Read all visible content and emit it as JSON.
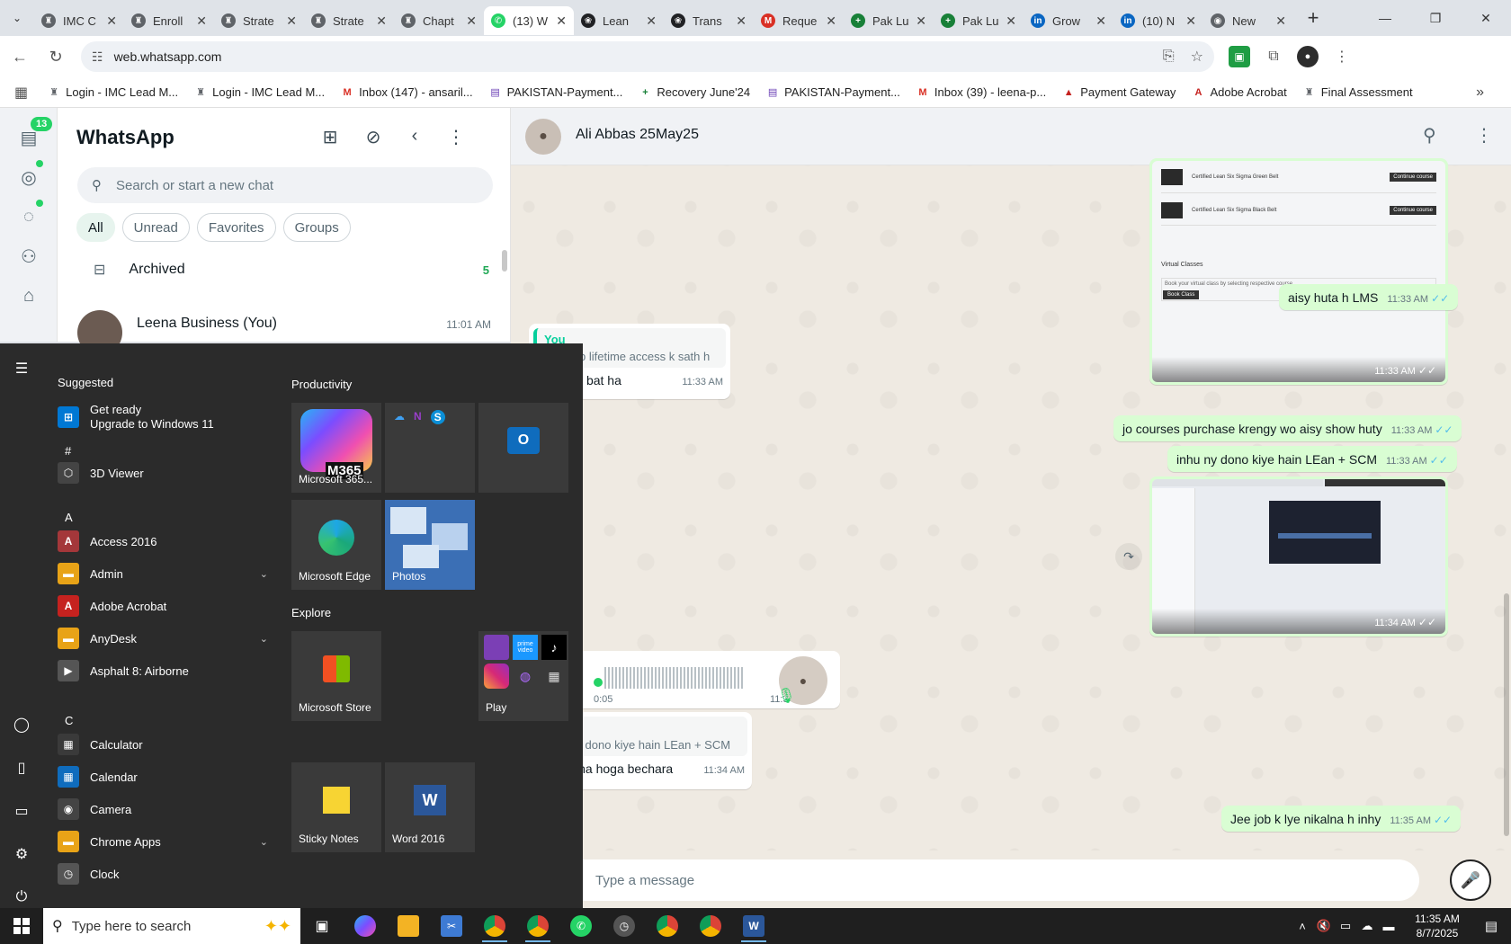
{
  "browser": {
    "tabs": [
      {
        "title": "IMC C",
        "color": "#5f6368",
        "glyph": "♜"
      },
      {
        "title": "Enroll",
        "color": "#5f6368",
        "glyph": "♜"
      },
      {
        "title": "Strate",
        "color": "#5f6368",
        "glyph": "♜"
      },
      {
        "title": "Strate",
        "color": "#5f6368",
        "glyph": "♜"
      },
      {
        "title": "Chapt",
        "color": "#5f6368",
        "glyph": "♜"
      },
      {
        "title": "(13) W",
        "color": "#25d366",
        "glyph": "✆"
      },
      {
        "title": "Lean",
        "color": "#202124",
        "glyph": "❀"
      },
      {
        "title": "Trans",
        "color": "#202124",
        "glyph": "❀"
      },
      {
        "title": "Reque",
        "color": "#d93025",
        "glyph": "M"
      },
      {
        "title": "Pak Lu",
        "color": "#188038",
        "glyph": "+"
      },
      {
        "title": "Pak Lu",
        "color": "#188038",
        "glyph": "+"
      },
      {
        "title": "Grow",
        "color": "#0a66c2",
        "glyph": "in"
      },
      {
        "title": "(10) N",
        "color": "#0a66c2",
        "glyph": "in"
      },
      {
        "title": "New",
        "color": "#5f6368",
        "glyph": "◉"
      }
    ],
    "url": "web.whatsapp.com",
    "bookmarks": [
      {
        "label": "Login - IMC Lead M...",
        "color": "#5f6368",
        "glyph": "♜"
      },
      {
        "label": "Login - IMC Lead M...",
        "color": "#5f6368",
        "glyph": "♜"
      },
      {
        "label": "Inbox (147) - ansaril...",
        "color": "#d93025",
        "glyph": "M"
      },
      {
        "label": "PAKISTAN-Payment...",
        "color": "#6a3fb5",
        "glyph": "▤"
      },
      {
        "label": "Recovery June'24",
        "color": "#188038",
        "glyph": "+"
      },
      {
        "label": "PAKISTAN-Payment...",
        "color": "#6a3fb5",
        "glyph": "▤"
      },
      {
        "label": "Inbox (39) - leena-p...",
        "color": "#d93025",
        "glyph": "M"
      },
      {
        "label": "Payment Gateway",
        "color": "#c5221f",
        "glyph": "▲"
      },
      {
        "label": "Adobe Acrobat",
        "color": "#c5221f",
        "glyph": "A"
      },
      {
        "label": "Final Assessment",
        "color": "#5f6368",
        "glyph": "♜"
      }
    ]
  },
  "whatsapp": {
    "unread_badge": "13",
    "title": "WhatsApp",
    "search_placeholder": "Search or start a new chat",
    "filters": [
      "All",
      "Unread",
      "Favorites",
      "Groups"
    ],
    "archived_label": "Archived",
    "archived_count": "5",
    "chat": {
      "name": "Leena Business (You)",
      "time": "11:01 AM"
    },
    "contact_name": "Ali Abbas 25May25",
    "composer_placeholder": "Type a message",
    "messages": {
      "img1_time": "11:33 AM",
      "m1": {
        "text": "aisy huta h LMS",
        "time": "11:33 AM"
      },
      "m2": {
        "quote_author": "You",
        "quote_text": "or ye sb lifetime access k sath h",
        "text": "Wah kia bat ha",
        "time": "11:33 AM"
      },
      "m3": {
        "text": "jo courses purchase krengy wo aisy show huty",
        "time": "11:33 AM"
      },
      "m4": {
        "text": "inhu ny dono kiye hain LEan + SCM",
        "time": "11:33 AM"
      },
      "img2_time": "11:34 AM",
      "voice": {
        "duration": "0:05",
        "time": "11:34 AM"
      },
      "m5": {
        "quote_author": "You",
        "quote_text": "inhu ny dono kiye hain LEan + SCM",
        "text": "arha likha hoga bechara",
        "time": "11:34 AM"
      },
      "m6": {
        "text": "Jee job k lye nikalna h inhy",
        "time": "11:35 AM"
      }
    },
    "img1": {
      "row1": "Certified Lean Six Sigma Green Belt",
      "row2": "Certified Lean Six Sigma Black Belt",
      "btn": "Continue course",
      "section": "Virtual Classes",
      "desc": "Book your virtual class by selecting respective course",
      "book": "Book Class"
    }
  },
  "start_menu": {
    "suggested_label": "Suggested",
    "suggested_app": {
      "line1": "Get ready",
      "line2": "Upgrade to Windows 11"
    },
    "letters": {
      "hash": "#",
      "a": "A",
      "c": "C"
    },
    "apps": [
      {
        "label": "3D Viewer",
        "glyph": "⬡",
        "color": "#444444",
        "chevron": false
      },
      {
        "label": "Access 2016",
        "glyph": "A",
        "color": "#a4373a",
        "chevron": false
      },
      {
        "label": "Admin",
        "glyph": "▬",
        "color": "#e8a317",
        "chevron": true
      },
      {
        "label": "Adobe Acrobat",
        "glyph": "A",
        "color": "#c5221f",
        "chevron": false
      },
      {
        "label": "AnyDesk",
        "glyph": "▬",
        "color": "#e8a317",
        "chevron": true
      },
      {
        "label": "Asphalt 8: Airborne",
        "glyph": "▶",
        "color": "#555555",
        "chevron": false
      },
      {
        "label": "Calculator",
        "glyph": "▦",
        "color": "#3a3a3a",
        "chevron": false
      },
      {
        "label": "Calendar",
        "glyph": "▦",
        "color": "#0f6cbd",
        "chevron": false
      },
      {
        "label": "Camera",
        "glyph": "◉",
        "color": "#444444",
        "chevron": false
      },
      {
        "label": "Chrome Apps",
        "glyph": "▬",
        "color": "#e8a317",
        "chevron": true
      },
      {
        "label": "Clock",
        "glyph": "◷",
        "color": "#555555",
        "chevron": false
      }
    ],
    "groups": {
      "productivity": "Productivity",
      "explore": "Explore"
    },
    "tiles": {
      "m365": "Microsoft 365...",
      "m365_badge": "M365",
      "edge": "Microsoft Edge",
      "photos": "Photos",
      "store": "Microsoft Store",
      "play": "Play",
      "sticky": "Sticky Notes",
      "word": "Word 2016",
      "prime": "prime video"
    }
  },
  "taskbar": {
    "search_placeholder": "Type here to search",
    "time": "11:35 AM",
    "date": "8/7/2025"
  }
}
